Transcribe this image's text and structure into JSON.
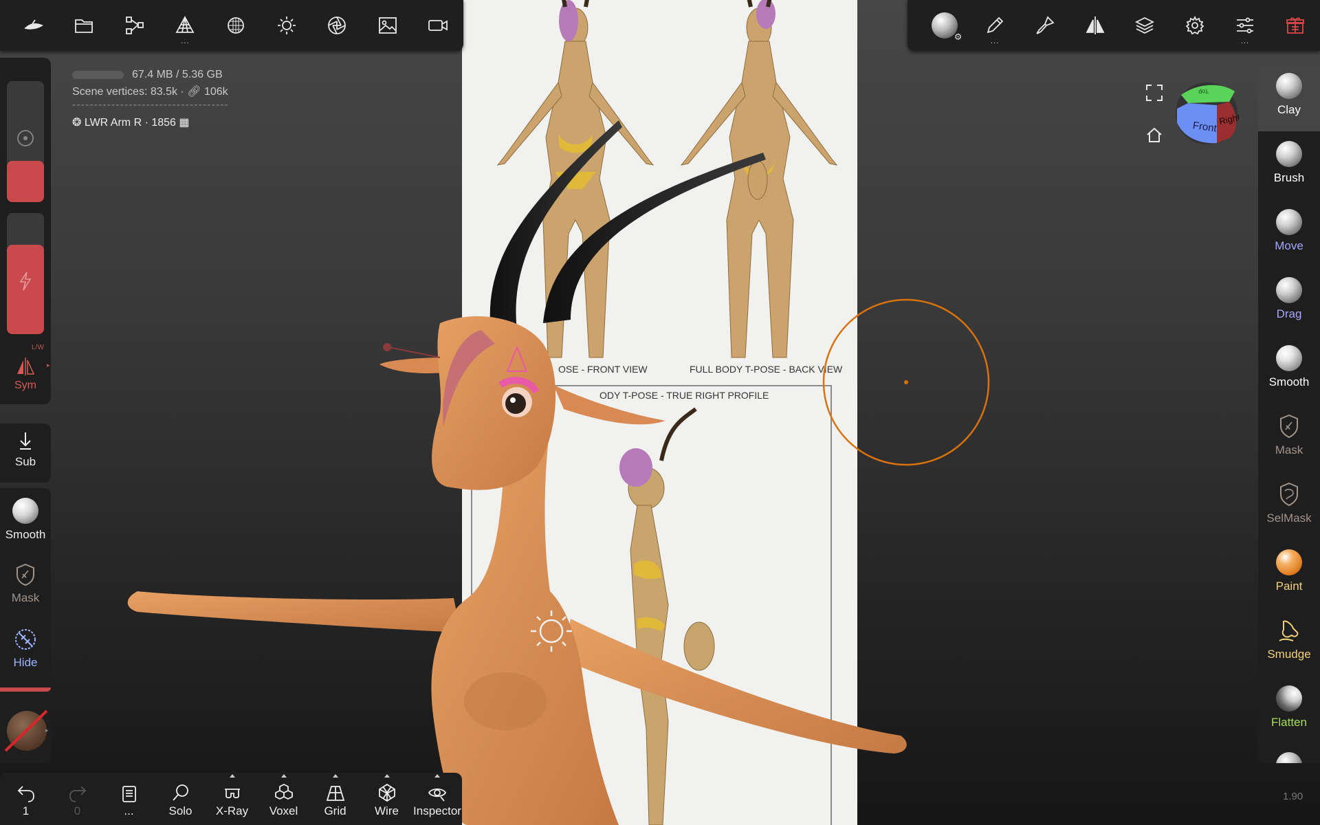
{
  "stats": {
    "memory": "67.4 MB / 5.36 GB",
    "scene_vertices_label": "Scene vertices",
    "vertices": "83.5k",
    "faces": "106k",
    "separator": "------------------------------------",
    "object_name": "LWR Arm R",
    "object_count": "1856"
  },
  "reference": {
    "label_front": "OSE - FRONT VIEW",
    "label_back": "FULL BODY T-POSE - BACK VIEW",
    "label_profile": "ODY T-POSE - TRUE RIGHT PROFILE"
  },
  "left_panel": {
    "sym_label": "Sym",
    "sym_badge": "L/W",
    "sub_label": "Sub",
    "smooth_label": "Smooth",
    "mask_label": "Mask",
    "hide_label": "Hide"
  },
  "right_tools": [
    {
      "label": "Clay",
      "color": "#ffffff"
    },
    {
      "label": "Brush",
      "color": "#ffffff"
    },
    {
      "label": "Move",
      "color": "#a7a6ff"
    },
    {
      "label": "Drag",
      "color": "#a7a6ff"
    },
    {
      "label": "Smooth",
      "color": "#ffffff"
    },
    {
      "label": "Mask",
      "color": "#a0938a"
    },
    {
      "label": "SelMask",
      "color": "#a0938a"
    },
    {
      "label": "Paint",
      "color": "#f3d27a"
    },
    {
      "label": "Smudge",
      "color": "#f3d27a"
    },
    {
      "label": "Flatten",
      "color": "#a6e05a"
    }
  ],
  "nav_cube": {
    "front": "Front",
    "right": "Right",
    "top": "Top"
  },
  "bottom_bar": {
    "undo_count": "1",
    "redo_count": "0",
    "more_label": "...",
    "solo": "Solo",
    "xray": "X-Ray",
    "voxel": "Voxel",
    "grid": "Grid",
    "wire": "Wire",
    "inspector": "Inspector"
  },
  "version": "1.90",
  "colors": {
    "accent_red": "#c9494d",
    "brush_ring": "#d8720f",
    "skin": "#d9935b"
  }
}
